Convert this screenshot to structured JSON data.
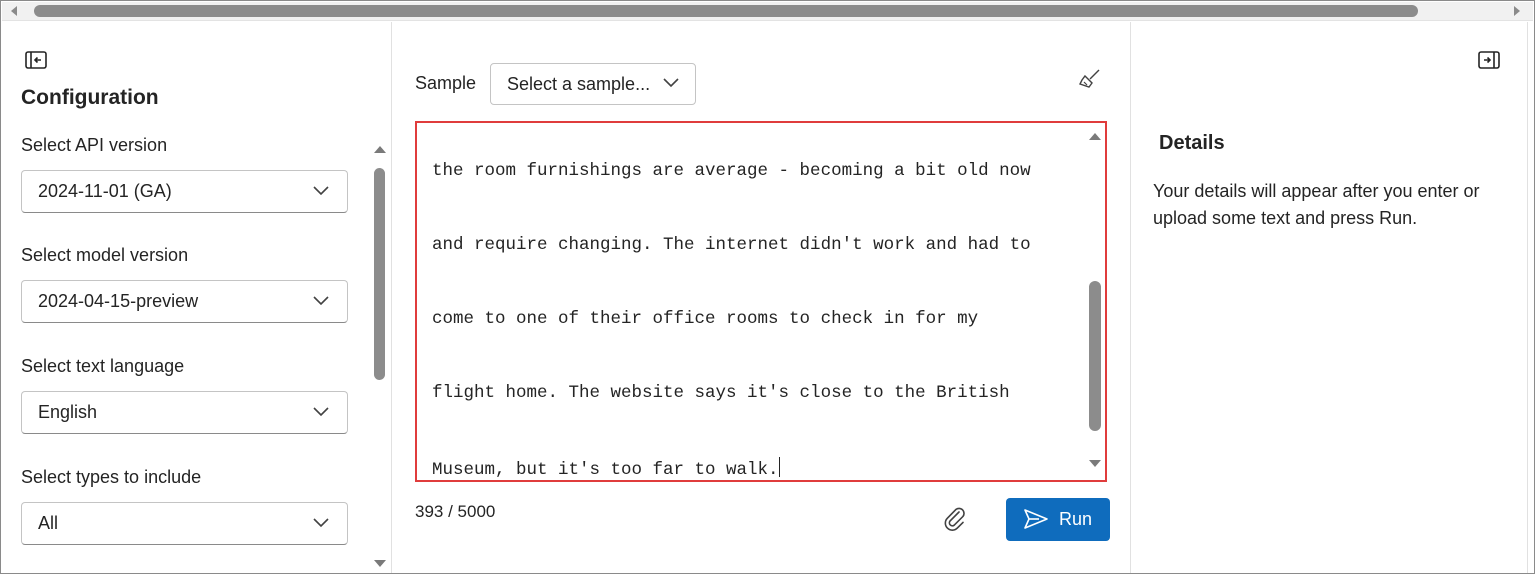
{
  "config": {
    "title": "Configuration",
    "api_version": {
      "label": "Select API version",
      "value": "2024-11-01 (GA)"
    },
    "model_version": {
      "label": "Select model version",
      "value": "2024-04-15-preview"
    },
    "text_language": {
      "label": "Select text language",
      "value": "English"
    },
    "types": {
      "label": "Select types to include",
      "value": "All"
    }
  },
  "editor": {
    "sample_label": "Sample",
    "sample_select": "Select a sample...",
    "lines": [
      "the room furnishings are average - becoming a bit old now",
      "and require changing. The internet didn't work and had to",
      "come to one of their office rooms to check in for my",
      "flight home. The website says it's close to the British",
      "Museum, but it's too far to walk."
    ],
    "counter": "393 / 5000",
    "run_label": "Run",
    "accent_color": "#0f6cbd",
    "highlight_color": "#e03c3c"
  },
  "details": {
    "title": "Details",
    "message": "Your details will appear after you enter or upload some text and press Run."
  }
}
